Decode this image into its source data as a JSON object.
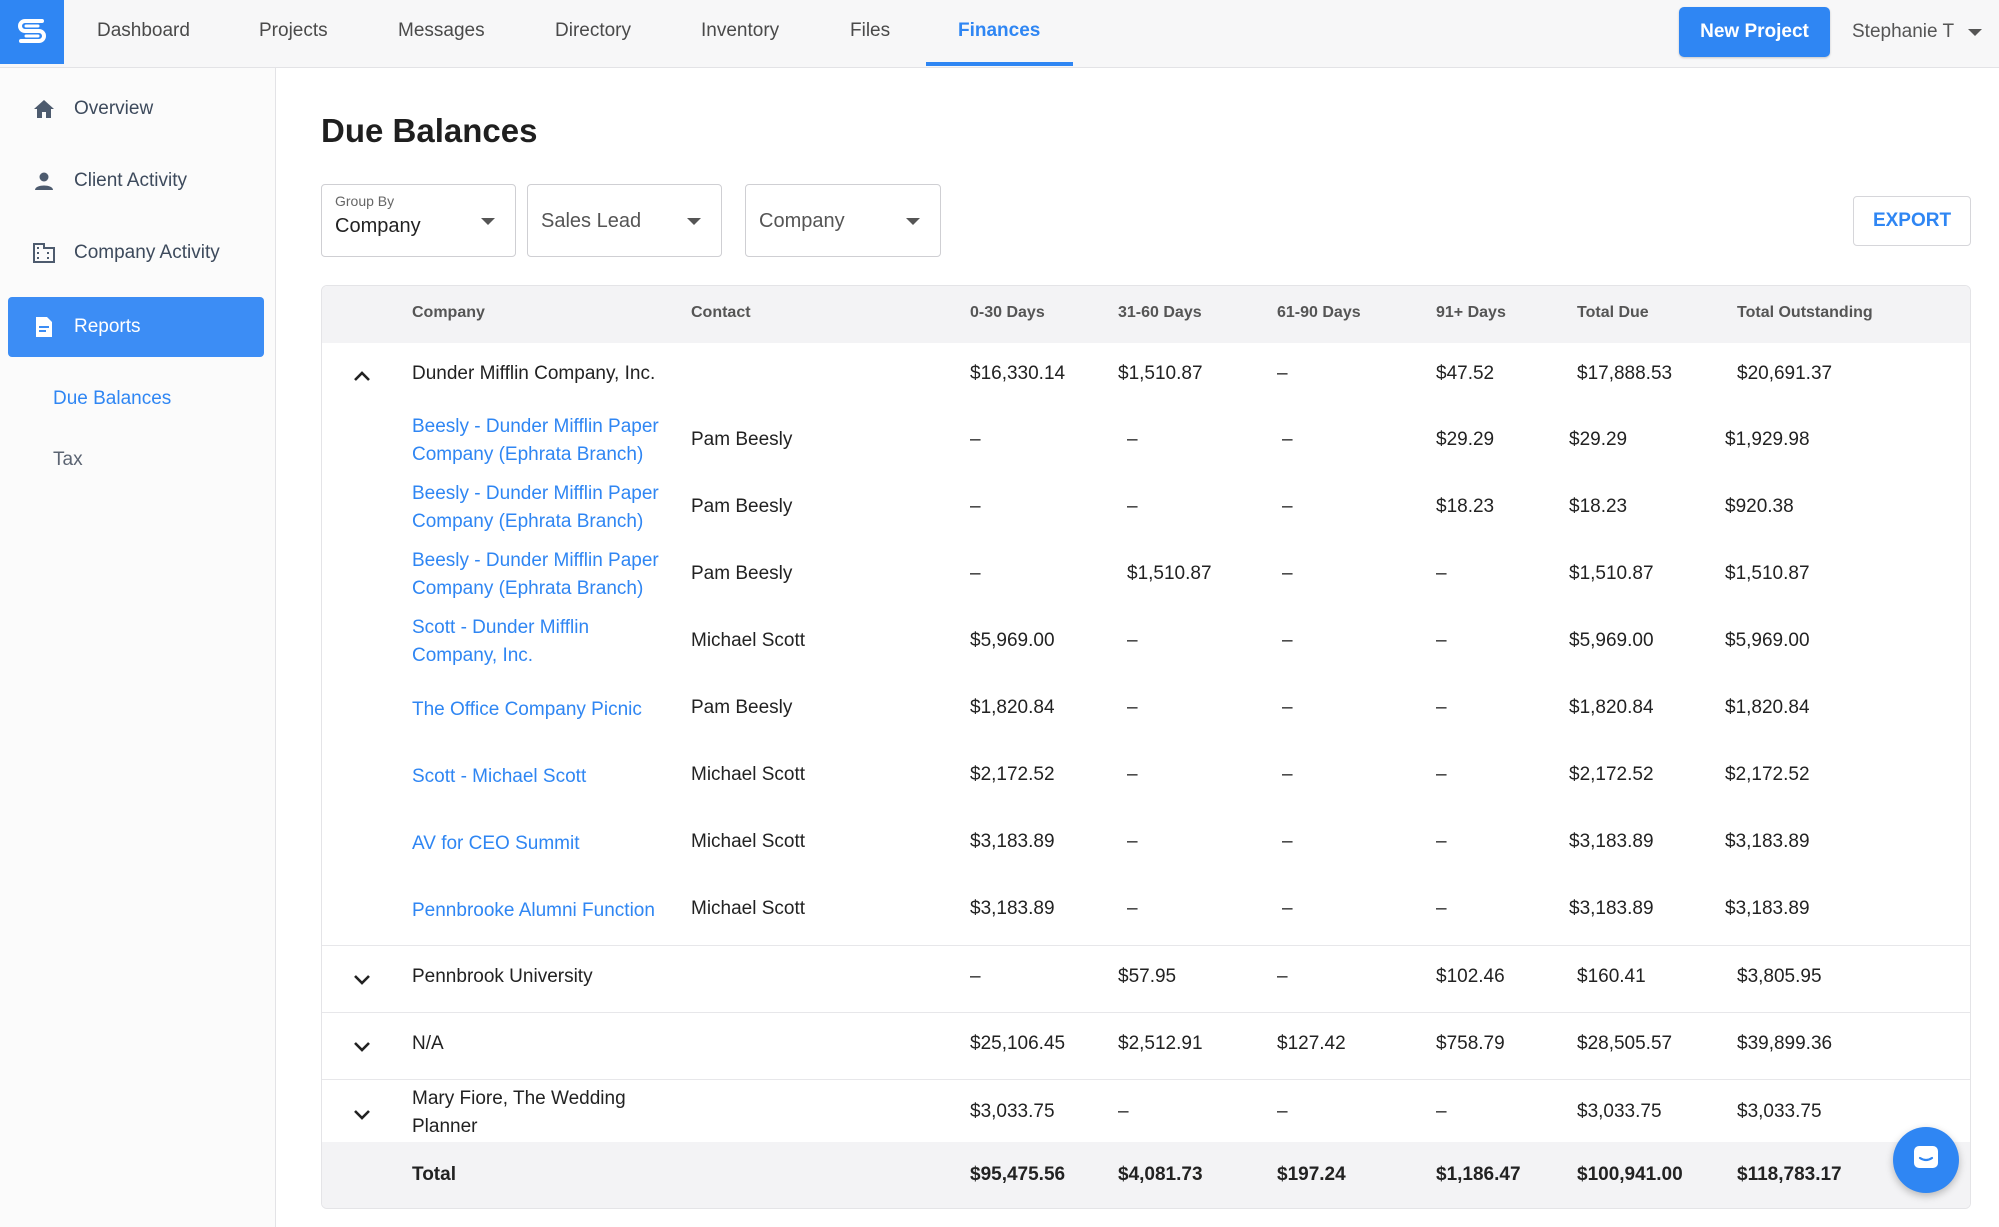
{
  "app": {
    "logo_icon": "brand-s-logo-icon",
    "brand_color": "#2f86f3"
  },
  "nav": {
    "tabs": [
      {
        "label": "Dashboard"
      },
      {
        "label": "Projects"
      },
      {
        "label": "Messages"
      },
      {
        "label": "Directory"
      },
      {
        "label": "Inventory"
      },
      {
        "label": "Files"
      },
      {
        "label": "Finances"
      }
    ],
    "active_tab": "Finances",
    "new_project_label": "New Project",
    "user_name": "Stephanie T"
  },
  "sidebar": {
    "items": [
      {
        "label": "Overview",
        "icon": "home-icon"
      },
      {
        "label": "Client Activity",
        "icon": "person-icon"
      },
      {
        "label": "Company Activity",
        "icon": "building-icon"
      },
      {
        "label": "Reports",
        "icon": "report-icon"
      }
    ],
    "sub_items": [
      {
        "label": "Due Balances"
      },
      {
        "label": "Tax"
      }
    ],
    "active_item": "Reports",
    "active_sub_item": "Due Balances"
  },
  "main": {
    "title": "Due Balances",
    "filters": {
      "group_by": {
        "label": "Group By",
        "value": "Company"
      },
      "sales_lead": {
        "value": "Sales Lead"
      },
      "company": {
        "value": "Company"
      }
    },
    "export_label": "EXPORT"
  },
  "table": {
    "columns": [
      "Company",
      "Contact",
      "0-30 Days",
      "31-60 Days",
      "61-90 Days",
      "91+ Days",
      "Total Due",
      "Total Outstanding"
    ],
    "groups": [
      {
        "name": "Dunder Mifflin Company, Inc.",
        "expanded": true,
        "d0_30": "$16,330.14",
        "d31_60": "$1,510.87",
        "d61_90": "–",
        "d91": "$47.52",
        "total_due": "$17,888.53",
        "total_outstanding": "$20,691.37",
        "rows": [
          {
            "project": "Beesly - Dunder Mifflin Paper Company (Ephrata Branch)",
            "contact": "Pam Beesly",
            "d0_30": "–",
            "d31_60": "–",
            "d61_90": "–",
            "d91": "$29.29",
            "total_due": "$29.29",
            "total_outstanding": "$1,929.98"
          },
          {
            "project": "Beesly - Dunder Mifflin Paper Company (Ephrata Branch)",
            "contact": "Pam Beesly",
            "d0_30": "–",
            "d31_60": "–",
            "d61_90": "–",
            "d91": "$18.23",
            "total_due": "$18.23",
            "total_outstanding": "$920.38"
          },
          {
            "project": "Beesly - Dunder Mifflin Paper Company (Ephrata Branch)",
            "contact": "Pam Beesly",
            "d0_30": "–",
            "d31_60": "$1,510.87",
            "d61_90": "–",
            "d91": "–",
            "total_due": "$1,510.87",
            "total_outstanding": "$1,510.87"
          },
          {
            "project": "Scott - Dunder Mifflin Company, Inc.",
            "contact": "Michael Scott",
            "d0_30": "$5,969.00",
            "d31_60": "–",
            "d61_90": "–",
            "d91": "–",
            "total_due": "$5,969.00",
            "total_outstanding": "$5,969.00"
          },
          {
            "project": "The Office Company Picnic",
            "contact": "Pam Beesly",
            "d0_30": "$1,820.84",
            "d31_60": "–",
            "d61_90": "–",
            "d91": "–",
            "total_due": "$1,820.84",
            "total_outstanding": "$1,820.84"
          },
          {
            "project": "Scott - Michael Scott",
            "contact": "Michael Scott",
            "d0_30": "$2,172.52",
            "d31_60": "–",
            "d61_90": "–",
            "d91": "–",
            "total_due": "$2,172.52",
            "total_outstanding": "$2,172.52"
          },
          {
            "project": "AV for CEO Summit",
            "contact": "Michael Scott",
            "d0_30": "$3,183.89",
            "d31_60": "–",
            "d61_90": "–",
            "d91": "–",
            "total_due": "$3,183.89",
            "total_outstanding": "$3,183.89"
          },
          {
            "project": "Pennbrooke Alumni Function",
            "contact": "Michael Scott",
            "d0_30": "$3,183.89",
            "d31_60": "–",
            "d61_90": "–",
            "d91": "–",
            "total_due": "$3,183.89",
            "total_outstanding": "$3,183.89"
          }
        ]
      },
      {
        "name": "Pennbrook University",
        "expanded": false,
        "d0_30": "–",
        "d31_60": "$57.95",
        "d61_90": "–",
        "d91": "$102.46",
        "total_due": "$160.41",
        "total_outstanding": "$3,805.95"
      },
      {
        "name": "N/A",
        "expanded": false,
        "d0_30": "$25,106.45",
        "d31_60": "$2,512.91",
        "d61_90": "$127.42",
        "d91": "$758.79",
        "total_due": "$28,505.57",
        "total_outstanding": "$39,899.36"
      },
      {
        "name": "Mary Fiore, The Wedding Planner",
        "expanded": false,
        "d0_30": "$3,033.75",
        "d31_60": "–",
        "d61_90": "–",
        "d91": "–",
        "total_due": "$3,033.75",
        "total_outstanding": "$3,033.75"
      }
    ],
    "total": {
      "label": "Total",
      "d0_30": "$95,475.56",
      "d31_60": "$4,081.73",
      "d61_90": "$197.24",
      "d91": "$1,186.47",
      "total_due": "$100,941.00",
      "total_outstanding": "$118,783.17"
    }
  },
  "chat_button_icon": "chat-bubble-icon"
}
